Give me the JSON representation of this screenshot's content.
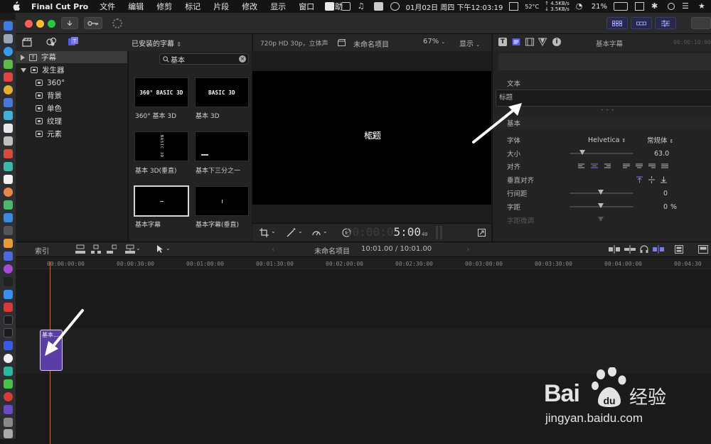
{
  "menubar": {
    "app_name": "Final Cut Pro",
    "items": [
      "文件",
      "编辑",
      "修剪",
      "标记",
      "片段",
      "修改",
      "显示",
      "窗口",
      "帮助"
    ],
    "temp": "52°C",
    "net_up": "↑ 4.5KB/s",
    "net_down": "↓ 3.5KB/s",
    "datetime": "01月02日 周四 下午12:03:19",
    "battery": "21%"
  },
  "browser": {
    "filter_label": "已安装的字幕",
    "search_value": "基本",
    "sidebar": [
      {
        "label": "字幕",
        "level": 0,
        "expanded": false,
        "selected": true
      },
      {
        "label": "发生器",
        "level": 0,
        "expanded": true,
        "selected": false
      },
      {
        "label": "360°",
        "level": 1
      },
      {
        "label": "背景",
        "level": 1
      },
      {
        "label": "单色",
        "level": 1
      },
      {
        "label": "纹理",
        "level": 1
      },
      {
        "label": "元素",
        "level": 1
      }
    ],
    "thumbnails": [
      {
        "label": "360° 基本 3D",
        "preview": "360° BASIC 3D"
      },
      {
        "label": "基本 3D",
        "preview": "BASIC 3D"
      },
      {
        "label": "基本 3D(垂直)",
        "preview": "BASIC 3D"
      },
      {
        "label": "基本下三分之一",
        "preview": ""
      },
      {
        "label": "基本字幕",
        "preview": ""
      },
      {
        "label": "基本字幕(垂直)",
        "preview": ""
      }
    ]
  },
  "viewer": {
    "format": "720p HD 30p，立体声",
    "project_name": "未命名项目",
    "zoom": "67%",
    "display_menu": "显示",
    "canvas_text": "标题",
    "timecode_dim": "00:00:0",
    "timecode_bright": "5:00",
    "timecode_frames": "40"
  },
  "inspector": {
    "title": "基本字幕",
    "timecode": "00:00:10:00",
    "section_text": "文本",
    "text_value": "标题",
    "section_basic": "基本",
    "rows": {
      "font_label": "字体",
      "font_value": "Helvetica",
      "font_style": "常规体",
      "size_label": "大小",
      "size_value": "63.0",
      "size_level": 0.2,
      "align_label": "对齐",
      "valign_label": "垂直对齐",
      "line_spacing_label": "行间距",
      "line_spacing_value": "0",
      "tracking_label": "字距",
      "tracking_value": "0",
      "tracking_unit": "%",
      "baseline_label": "字距微调"
    }
  },
  "timeline": {
    "index_label": "索引",
    "project_name": "未命名项目",
    "duration": "10:01.00 / 10:01.00",
    "ruler_labels": [
      "00:00:00:00",
      "00:00:30:00",
      "00:01:00:00",
      "00:01:30:00",
      "00:02:00:00",
      "00:02:30:00",
      "00:03:00:00",
      "00:03:30:00",
      "00:04:00:00",
      "00:04:30"
    ],
    "clip_title": "基本..."
  },
  "colors": {
    "accent": "#5a3ea3",
    "playhead": "#c0644a",
    "highlight_button": "#28284a"
  },
  "watermark": {
    "brand": "Bai",
    "brand_cn": "经验",
    "url": "jingyan.baidu.com"
  }
}
